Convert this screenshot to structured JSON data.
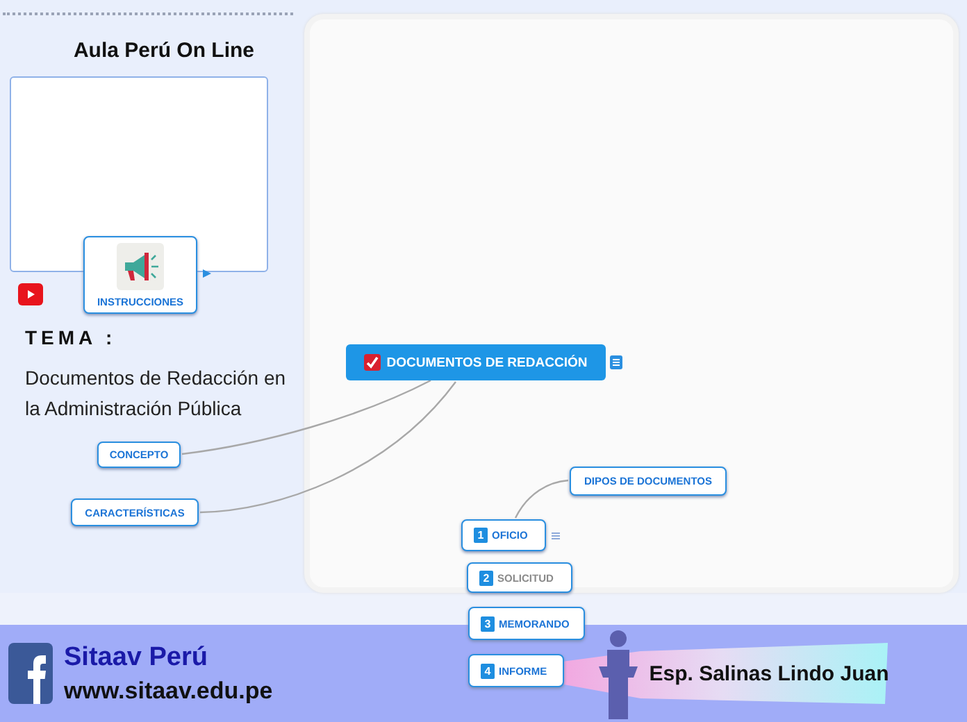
{
  "header": {
    "title": "Aula Perú On Line"
  },
  "topic": {
    "heading": "TEMA :",
    "text": "Documentos de Redacción en la Administración Pública"
  },
  "mindmap": {
    "central": {
      "label": "DOCUMENTOS DE REDACCIÓN"
    },
    "nodes": [
      {
        "label": "INSTRUCCIONES",
        "kind": "image"
      },
      {
        "label": "CONCEPTO",
        "kind": "plain"
      },
      {
        "label": "CARACTERÍSTICAS",
        "kind": "plain"
      },
      {
        "label": "DIPOS DE DOCUMENTOS",
        "kind": "plain"
      }
    ],
    "list": [
      {
        "number": "1",
        "label": "OFICIO",
        "muted": false
      },
      {
        "number": "2",
        "label": "SOLICITUD",
        "muted": true
      },
      {
        "number": "3",
        "label": "MEMORANDO",
        "muted": false
      },
      {
        "number": "4",
        "label": "INFORME",
        "muted": false
      }
    ]
  },
  "footer": {
    "brand": "Sitaav Perú",
    "url": "www.sitaav.edu.pe",
    "author": "Esp. Salinas Lindo Juan"
  }
}
